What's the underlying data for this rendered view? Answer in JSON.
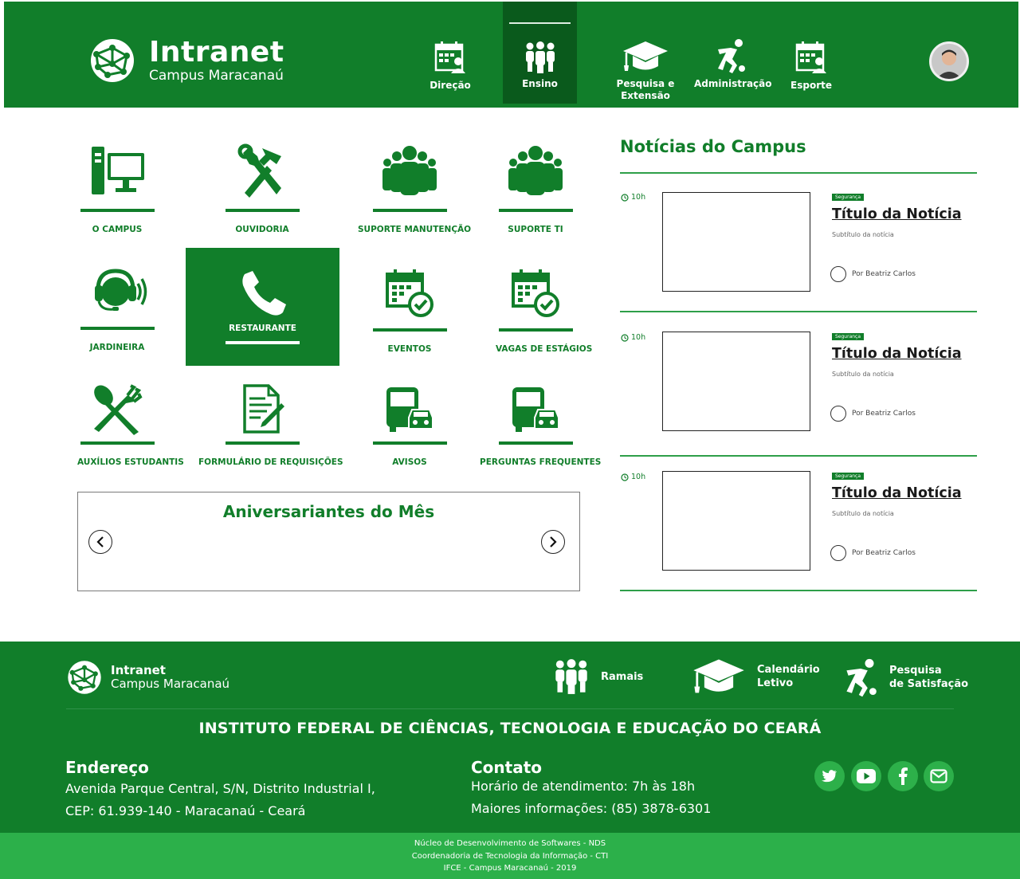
{
  "header": {
    "logo_title": "Intranet",
    "logo_subtitle": "Campus Maracanaú",
    "nav": [
      {
        "label": "Direção",
        "icon": "calendar-people-icon"
      },
      {
        "label": "Ensino",
        "icon": "group-icon",
        "active": true
      },
      {
        "label": "Pesquisa e Extensão",
        "icon": "graduation-cap-icon"
      },
      {
        "label": "Administração",
        "icon": "runner-icon"
      },
      {
        "label": "Esporte",
        "icon": "calendar-people-icon"
      }
    ]
  },
  "tiles": [
    {
      "label": "O CAMPUS",
      "icon": "computer-icon"
    },
    {
      "label": "OUVIDORIA",
      "icon": "tools-icon"
    },
    {
      "label": "SUPORTE MANUTENÇÃO",
      "icon": "people-group-icon"
    },
    {
      "label": "SUPORTE TI",
      "icon": "people-group-icon"
    },
    {
      "label": "JARDINEIRA",
      "icon": "headset-icon"
    },
    {
      "label": "RESTAURANTE",
      "icon": "phone-icon",
      "selected": true
    },
    {
      "label": "EVENTOS",
      "icon": "calendar-check-icon"
    },
    {
      "label": "VAGAS DE ESTÁGIOS",
      "icon": "calendar-check-icon"
    },
    {
      "label": "AUXÍLIOS ESTUDANTIS",
      "icon": "fork-knife-icon"
    },
    {
      "label": "FORMULÁRIO DE REQUISIÇÕES",
      "icon": "form-icon"
    },
    {
      "label": "AVISOS",
      "icon": "bus-car-icon"
    },
    {
      "label": "PERGUNTAS FREQUENTES",
      "icon": "bus-car-icon"
    }
  ],
  "birthdays": {
    "title": "Aniversariantes do Mês"
  },
  "news": {
    "title": "Notícias do Campus",
    "items": [
      {
        "time": "10h",
        "tag": "Segurança",
        "headline": "Título da Notícia",
        "subtitle": "Subtítulo da notícia",
        "author": "Por Beatriz Carlos"
      },
      {
        "time": "10h",
        "tag": "Segurança",
        "headline": "Título da Notícia",
        "subtitle": "Subtítulo da notícia",
        "author": "Por Beatriz Carlos"
      },
      {
        "time": "10h",
        "tag": "Segurança",
        "headline": "Título da Notícia",
        "subtitle": "Subtítulo da notícia",
        "author": "Por Beatriz Carlos"
      }
    ]
  },
  "footer": {
    "logo_title": "Intranet",
    "logo_subtitle": "Campus Maracanaú",
    "links": [
      {
        "label": "Ramais",
        "icon": "group-icon"
      },
      {
        "label_line1": "Calendário",
        "label_line2": "Letivo",
        "icon": "graduation-cap-icon"
      },
      {
        "label_line1": "Pesquisa",
        "label_line2": "de Satisfação",
        "icon": "runner-icon"
      }
    ],
    "institution": "INSTITUTO FEDERAL DE CIÊNCIAS, TECNOLOGIA E EDUCAÇÃO DO CEARÁ",
    "address": {
      "heading": "Endereço",
      "line1": "Avenida Parque Central, S/N, Distrito Industrial I,",
      "line2": "CEP: 61.939-140 - Maracanaú - Ceará"
    },
    "contact": {
      "heading": "Contato",
      "line1": "Horário de atendimento: 7h às 18h",
      "line2": "Maiores informações: (85) 3878-6301"
    },
    "social": [
      "twitter-icon",
      "youtube-icon",
      "facebook-icon",
      "mail-icon"
    ],
    "credits": [
      "Núcleo de Desenvolvimento de Softwares - NDS",
      "Coordenadoria de Tecnologia da Informação - CTI",
      "IFCE - Campus Maracanaú - 2019"
    ]
  },
  "colors": {
    "primary": "#117e2a",
    "active_nav": "#0a5a1c",
    "light": "#2cb04a"
  }
}
